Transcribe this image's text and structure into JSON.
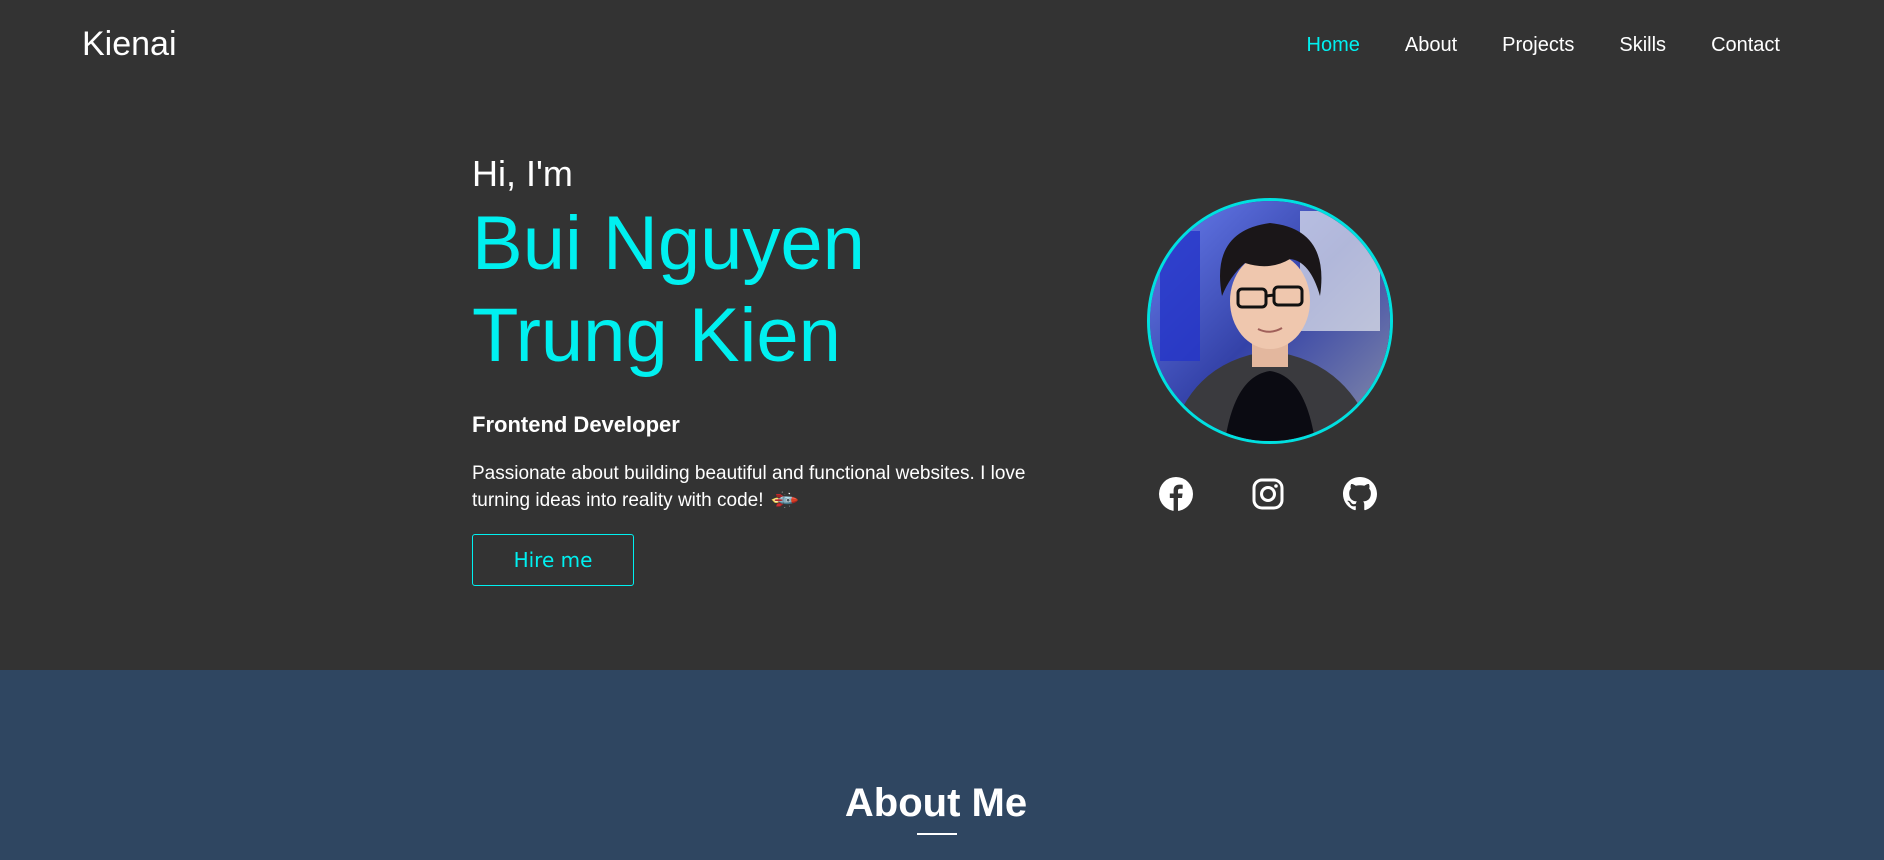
{
  "header": {
    "logo": "Kienai",
    "nav": [
      {
        "label": "Home",
        "active": true
      },
      {
        "label": "About",
        "active": false
      },
      {
        "label": "Projects",
        "active": false
      },
      {
        "label": "Skills",
        "active": false
      },
      {
        "label": "Contact",
        "active": false
      }
    ]
  },
  "hero": {
    "greeting": "Hi, I'm",
    "name_line1": "Bui Nguyen",
    "name_line2": "Trung Kien",
    "role": "Frontend Developer",
    "description": "Passionate about building beautiful and functional websites. I love turning ideas into reality with code!",
    "rocket_icon": "🚀",
    "hire_button": "Hire me",
    "socials": [
      "facebook-icon",
      "instagram-icon",
      "github-icon"
    ]
  },
  "about": {
    "title": "About Me"
  },
  "colors": {
    "accent": "#00f0f0",
    "background": "#333333",
    "about_background": "#2f4661"
  }
}
